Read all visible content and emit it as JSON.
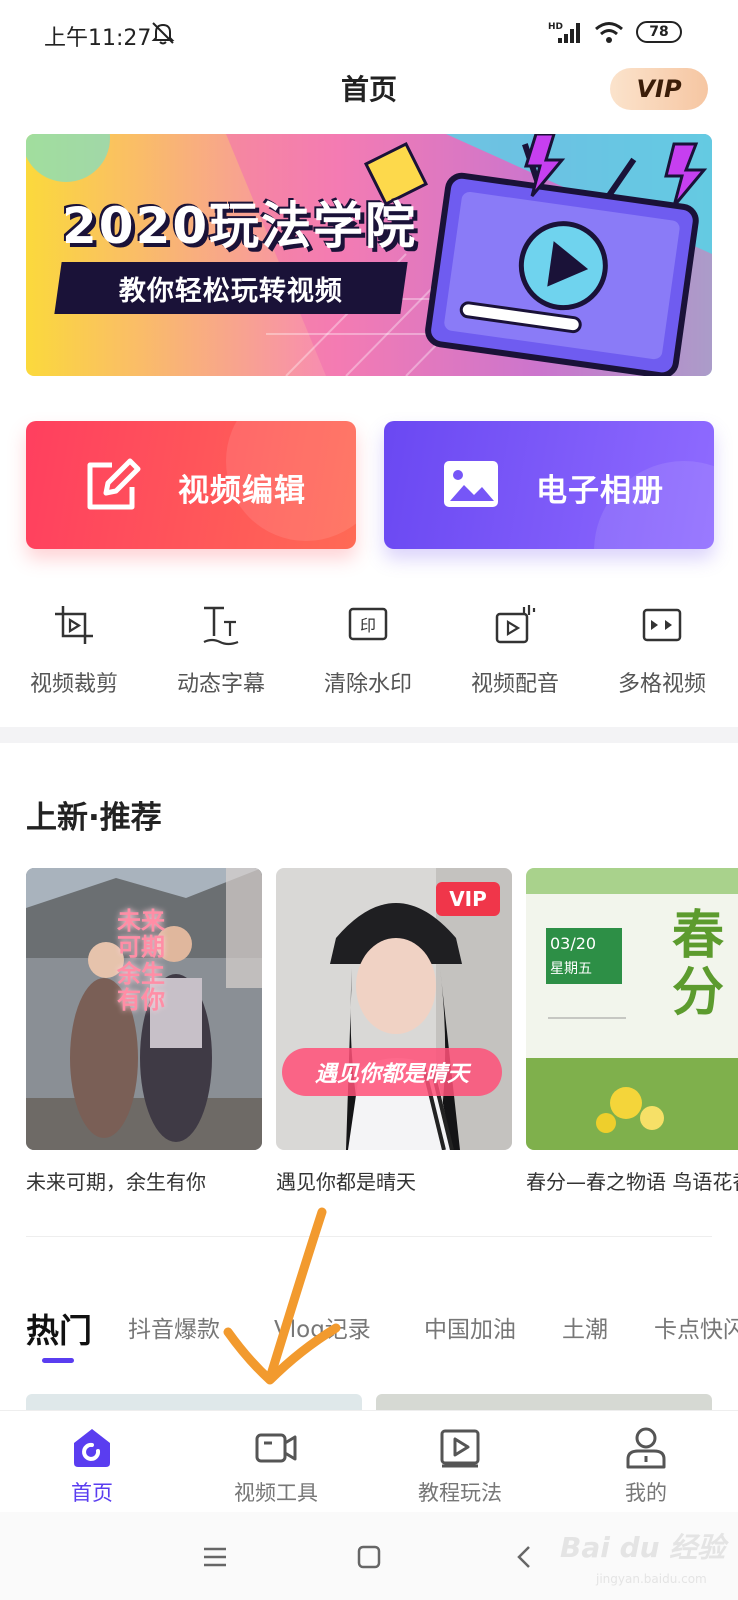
{
  "status_bar": {
    "time": "上午11:27",
    "signal": "HD",
    "battery": "78"
  },
  "header": {
    "title": "首页",
    "vip": "VIP"
  },
  "banner": {
    "title": "2020玩法学院",
    "subtitle": "教你轻松玩转视频"
  },
  "cards": {
    "edit": "视频编辑",
    "album": "电子相册"
  },
  "tools": [
    {
      "label": "视频裁剪",
      "icon": "crop-icon"
    },
    {
      "label": "动态字幕",
      "icon": "text-icon"
    },
    {
      "label": "清除水印",
      "icon": "watermark-icon"
    },
    {
      "label": "视频配音",
      "icon": "dubbing-icon"
    },
    {
      "label": "多格视频",
      "icon": "grid-video-icon"
    }
  ],
  "recommend": {
    "title": "上新·推荐",
    "items": [
      {
        "caption": "未来可期，余生有你",
        "overlay": "未来可期 余生有你"
      },
      {
        "caption": "遇见你都是晴天",
        "overlay": "遇见你都是晴天",
        "badge": "VIP"
      },
      {
        "caption": "春分—春之物语 鸟语花香",
        "overlay": "春分",
        "date": "03/20",
        "weekday": "星期五"
      }
    ]
  },
  "categories": [
    "热门",
    "抖音爆款",
    "Vlog记录",
    "中国加油",
    "土潮",
    "卡点快闪"
  ],
  "bottom_nav": [
    {
      "label": "首页",
      "icon": "home-icon",
      "active": true
    },
    {
      "label": "视频工具",
      "icon": "video-camera-icon",
      "active": false
    },
    {
      "label": "教程玩法",
      "icon": "tutorial-play-icon",
      "active": false
    },
    {
      "label": "我的",
      "icon": "profile-icon",
      "active": false
    }
  ],
  "watermark": {
    "brand": "Bai du 经验",
    "url": "jingyan.baidu.com"
  },
  "colors": {
    "accent": "#5a3df0",
    "red_card": "#ff4560",
    "purple_card": "#7656f7",
    "arrow": "#f29a2e"
  }
}
